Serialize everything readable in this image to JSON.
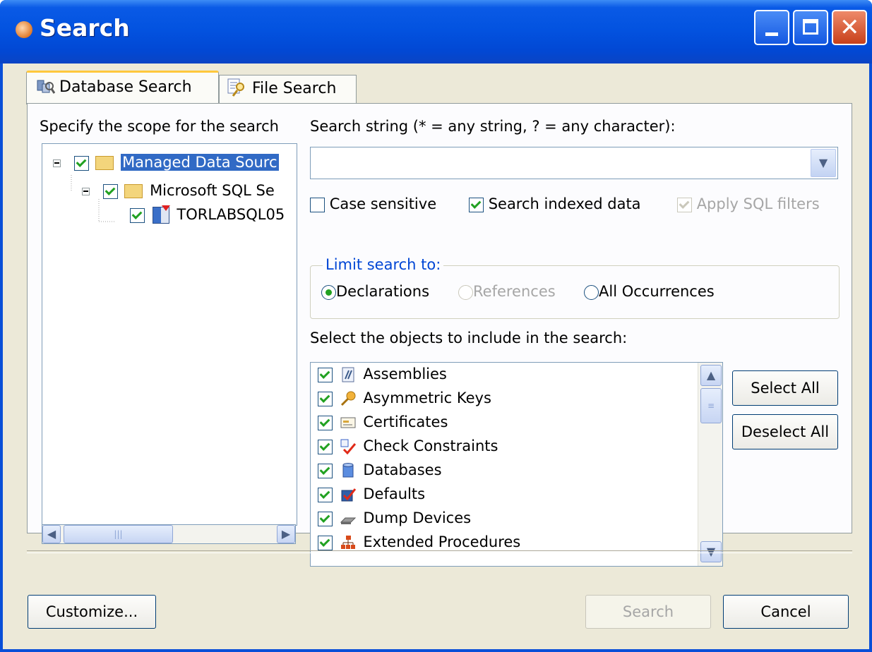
{
  "window": {
    "title": "Search"
  },
  "tabs": [
    {
      "label": "Database Search",
      "icon": "database-search-icon",
      "active": true
    },
    {
      "label": "File Search",
      "icon": "file-search-icon",
      "active": false
    }
  ],
  "scope": {
    "label": "Specify the scope for the search",
    "tree": [
      {
        "label": "Managed Data Sourc",
        "checked": true,
        "selected": true
      },
      {
        "label": "Microsoft SQL Se",
        "checked": true
      },
      {
        "label": "TORLABSQL05",
        "checked": true
      }
    ]
  },
  "search": {
    "label": "Search string (* = any string, ? = any character):",
    "value": ""
  },
  "options": {
    "case_sensitive": {
      "label": "Case sensitive",
      "checked": false
    },
    "search_indexed": {
      "label": "Search indexed data",
      "checked": true
    },
    "apply_sql_filters": {
      "label": "Apply SQL filters",
      "checked": true,
      "disabled": true
    }
  },
  "limit": {
    "label": "Limit search to:",
    "options": [
      {
        "label": "Declarations",
        "selected": true
      },
      {
        "label": "References",
        "selected": false,
        "disabled": true
      },
      {
        "label": "All Occurrences",
        "selected": false
      }
    ]
  },
  "objects": {
    "label": "Select the objects to include in the search:",
    "items": [
      {
        "label": "Assemblies",
        "checked": true,
        "icon": "assembly-icon"
      },
      {
        "label": "Asymmetric Keys",
        "checked": true,
        "icon": "key-icon"
      },
      {
        "label": "Certificates",
        "checked": true,
        "icon": "certificate-icon"
      },
      {
        "label": "Check Constraints",
        "checked": true,
        "icon": "check-constraint-icon"
      },
      {
        "label": "Databases",
        "checked": true,
        "icon": "database-icon"
      },
      {
        "label": "Defaults",
        "checked": true,
        "icon": "default-icon"
      },
      {
        "label": "Dump Devices",
        "checked": true,
        "icon": "dump-device-icon"
      },
      {
        "label": "Extended Procedures",
        "checked": true,
        "icon": "extended-procedure-icon"
      }
    ]
  },
  "buttons": {
    "select_all": "Select All",
    "deselect_all": "Deselect All",
    "customize": "Customize...",
    "search": "Search",
    "cancel": "Cancel"
  }
}
